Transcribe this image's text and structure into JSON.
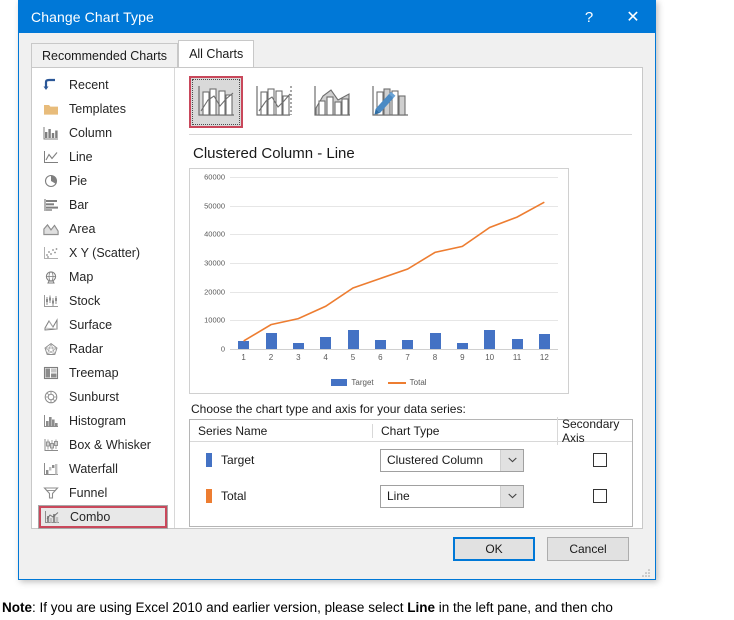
{
  "dialog": {
    "title": "Change Chart Type",
    "help_label": "?",
    "close_label": "✕",
    "tabs": [
      {
        "label": "Recommended Charts",
        "active": false
      },
      {
        "label": "All Charts",
        "active": true
      }
    ]
  },
  "sidebar": {
    "items": [
      {
        "label": "Recent",
        "icon": "recent-icon",
        "selected": false
      },
      {
        "label": "Templates",
        "icon": "templates-folder-icon",
        "selected": false
      },
      {
        "label": "Column",
        "icon": "column-chart-icon",
        "selected": false
      },
      {
        "label": "Line",
        "icon": "line-chart-icon",
        "selected": false
      },
      {
        "label": "Pie",
        "icon": "pie-chart-icon",
        "selected": false
      },
      {
        "label": "Bar",
        "icon": "bar-chart-icon",
        "selected": false
      },
      {
        "label": "Area",
        "icon": "area-chart-icon",
        "selected": false
      },
      {
        "label": "X Y (Scatter)",
        "icon": "scatter-chart-icon",
        "selected": false
      },
      {
        "label": "Map",
        "icon": "map-chart-icon",
        "selected": false
      },
      {
        "label": "Stock",
        "icon": "stock-chart-icon",
        "selected": false
      },
      {
        "label": "Surface",
        "icon": "surface-chart-icon",
        "selected": false
      },
      {
        "label": "Radar",
        "icon": "radar-chart-icon",
        "selected": false
      },
      {
        "label": "Treemap",
        "icon": "treemap-chart-icon",
        "selected": false
      },
      {
        "label": "Sunburst",
        "icon": "sunburst-chart-icon",
        "selected": false
      },
      {
        "label": "Histogram",
        "icon": "histogram-chart-icon",
        "selected": false
      },
      {
        "label": "Box & Whisker",
        "icon": "box-whisker-chart-icon",
        "selected": false
      },
      {
        "label": "Waterfall",
        "icon": "waterfall-chart-icon",
        "selected": false
      },
      {
        "label": "Funnel",
        "icon": "funnel-chart-icon",
        "selected": false
      },
      {
        "label": "Combo",
        "icon": "combo-chart-icon",
        "selected": true
      }
    ]
  },
  "variants": [
    {
      "name": "clustered-column-line",
      "selected": true
    },
    {
      "name": "clustered-column-line-on-secondary-axis",
      "selected": false
    },
    {
      "name": "stacked-area-clustered-column",
      "selected": false
    },
    {
      "name": "custom-combination",
      "selected": false
    }
  ],
  "preview": {
    "title": "Clustered Column - Line"
  },
  "series_section": {
    "instruction": "Choose the chart type and axis for your data series:",
    "columns": [
      "Series Name",
      "Chart Type",
      "Secondary Axis"
    ],
    "rows": [
      {
        "name": "Target",
        "swatch": "#4472c4",
        "chart_type": "Clustered Column",
        "secondary_axis": false
      },
      {
        "name": "Total",
        "swatch": "#ed7d31",
        "chart_type": "Line",
        "secondary_axis": false
      }
    ]
  },
  "footer": {
    "ok_label": "OK",
    "cancel_label": "Cancel"
  },
  "note": {
    "prefix": "Note",
    "text_1": ": If you are using Excel 2010 and earlier version, please select ",
    "bold_1": "Line",
    "text_2": " in the left pane, and then cho"
  },
  "colors": {
    "accent": "#0078d7",
    "series_target": "#4472c4",
    "series_total": "#ed7d31",
    "selection_outline": "#c9485b"
  },
  "chart_data": {
    "type": "bar",
    "title": "Clustered Column - Line",
    "xlabel": "",
    "ylabel": "",
    "ylim": [
      0,
      60000
    ],
    "yticks": [
      0,
      10000,
      20000,
      30000,
      40000,
      50000,
      60000
    ],
    "categories": [
      "1",
      "2",
      "3",
      "4",
      "5",
      "6",
      "7",
      "8",
      "9",
      "10",
      "11",
      "12"
    ],
    "grid": true,
    "legend_position": "bottom",
    "series": [
      {
        "name": "Target",
        "type": "bar",
        "color": "#4472c4",
        "values": [
          2800,
          5600,
          2100,
          4100,
          6700,
          3200,
          3200,
          5500,
          2100,
          6700,
          3500,
          5200
        ]
      },
      {
        "name": "Total",
        "type": "line",
        "color": "#ed7d31",
        "values": [
          2800,
          8500,
          10600,
          14900,
          21300,
          24600,
          27900,
          33700,
          35800,
          42400,
          46000,
          51200
        ]
      }
    ]
  }
}
